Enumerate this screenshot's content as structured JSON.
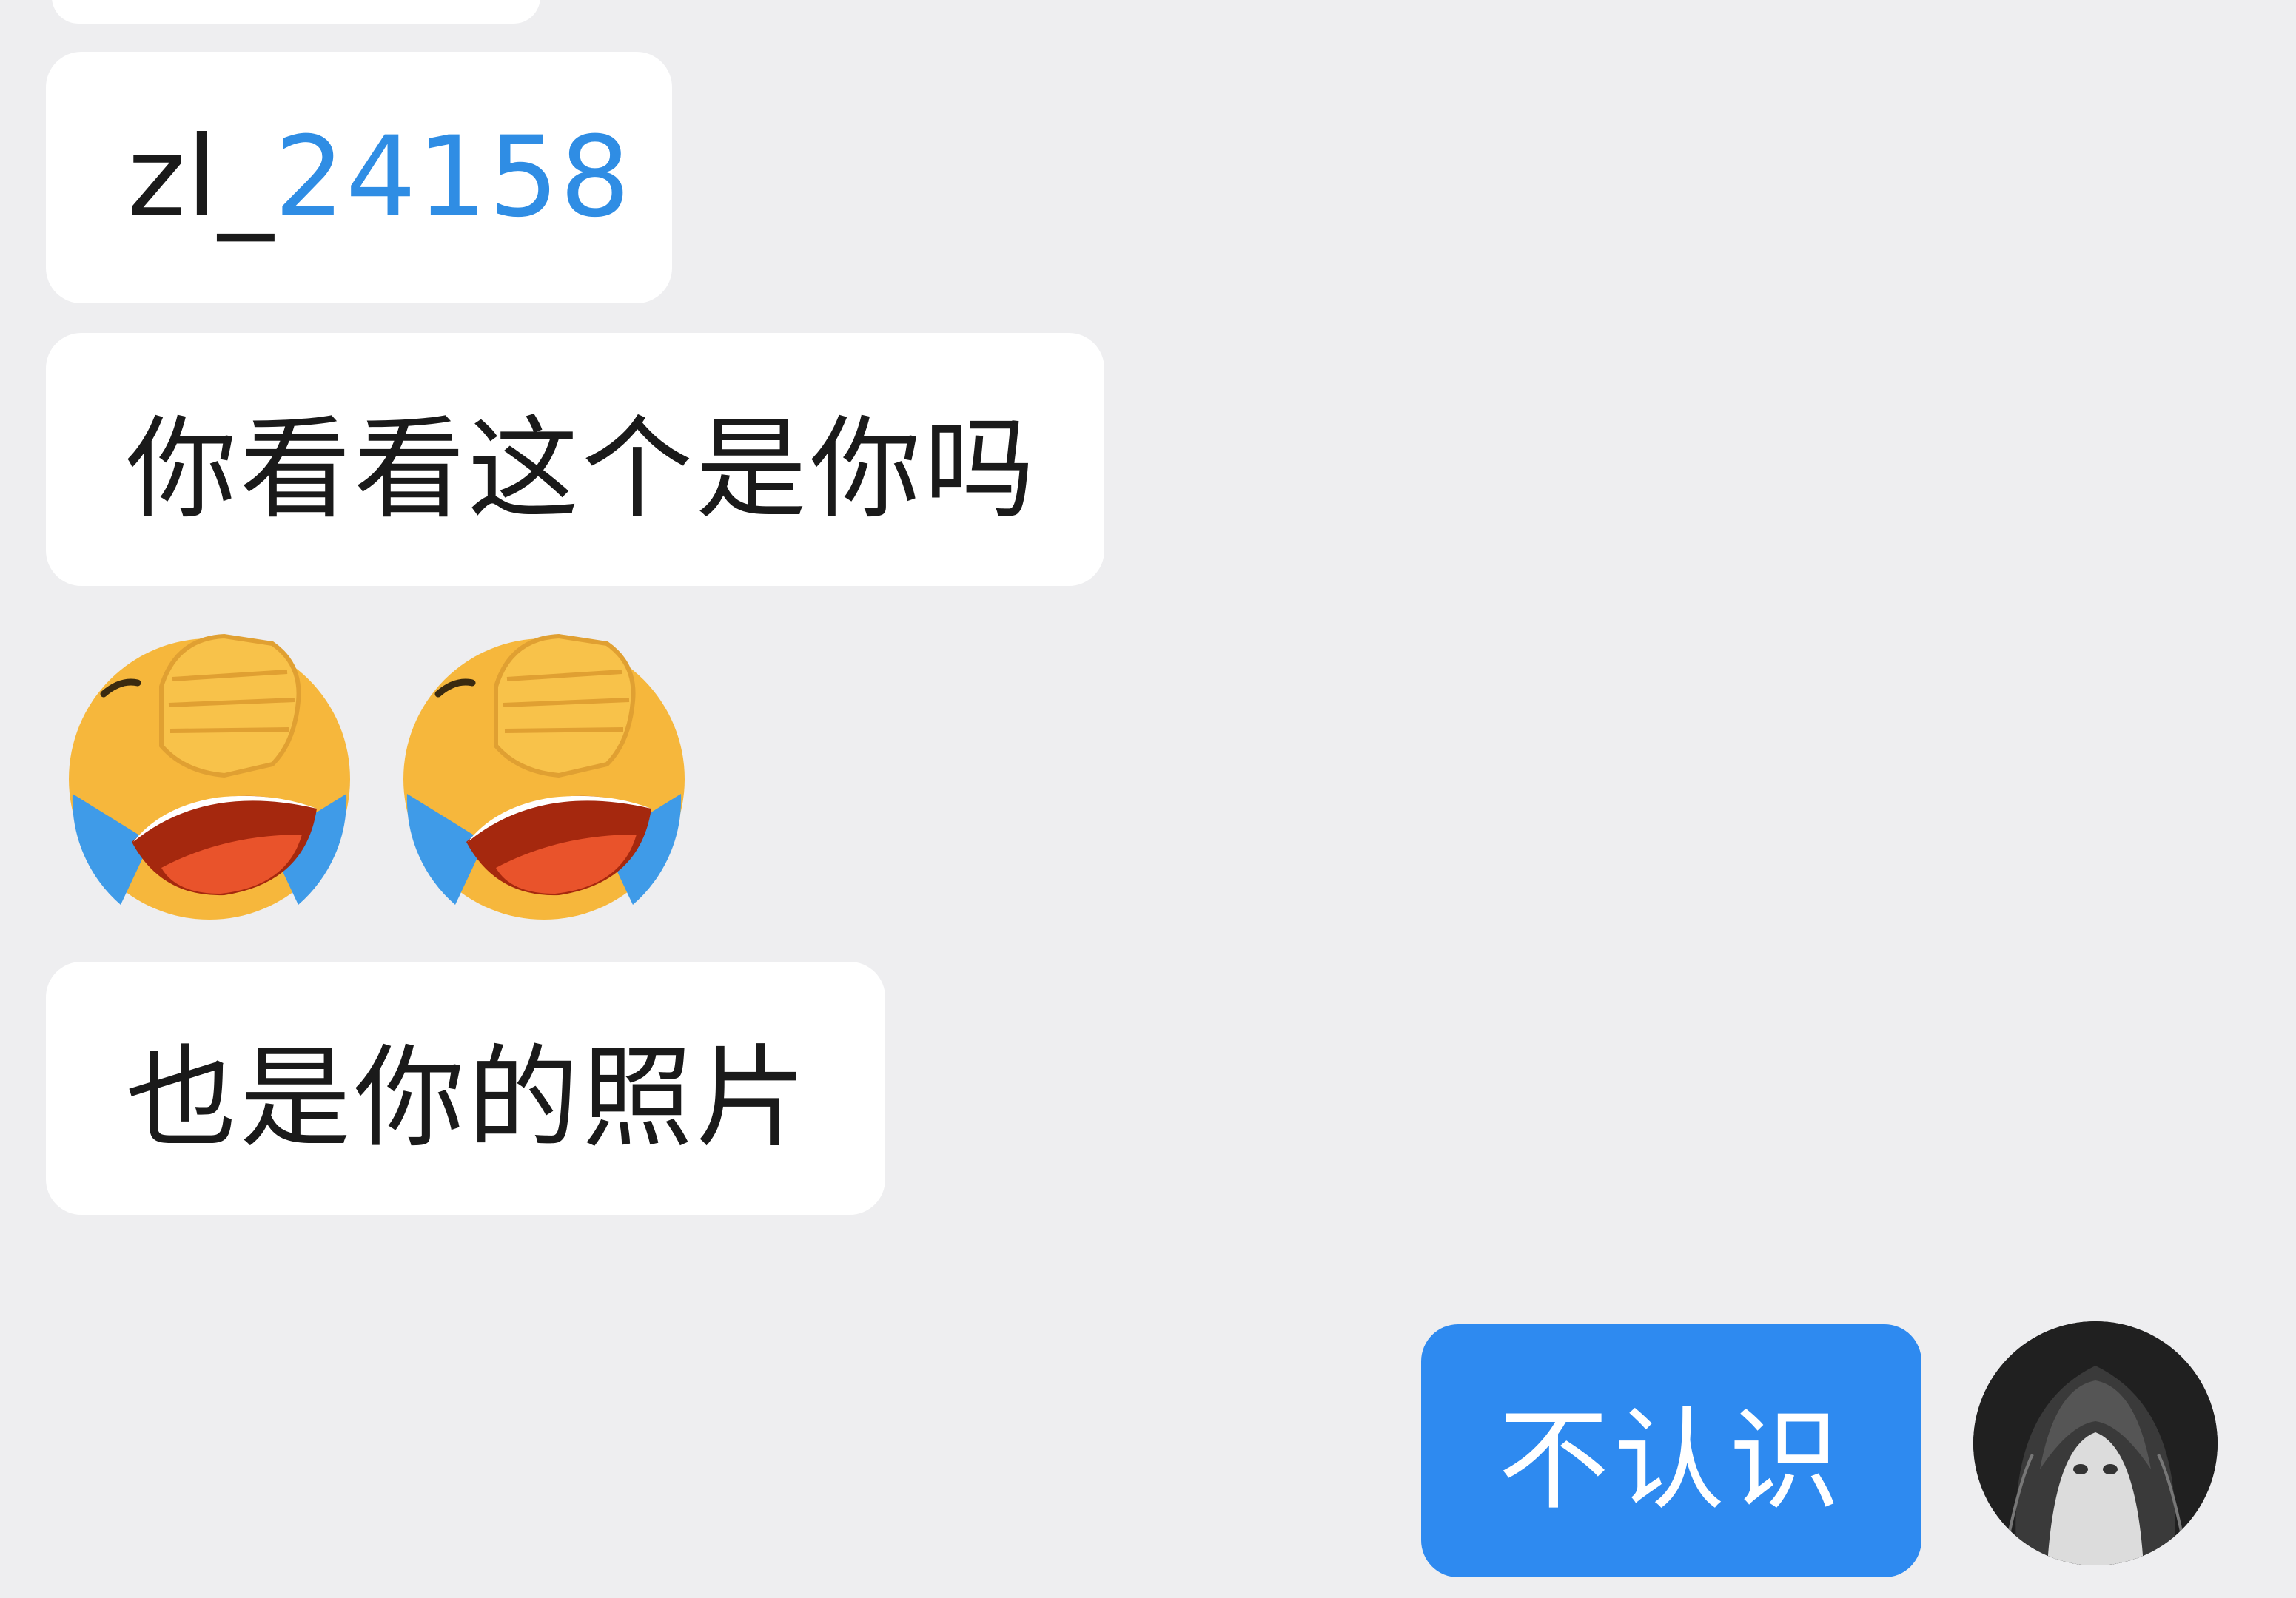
{
  "messages": [
    {
      "side": "left",
      "type": "text",
      "prefix": "zl_",
      "link": "24158"
    },
    {
      "side": "left",
      "type": "text",
      "text": "你看看这个是你吗"
    },
    {
      "side": "left",
      "type": "emoji",
      "emojis": [
        "facepalm-crying-emoji",
        "facepalm-crying-emoji"
      ]
    },
    {
      "side": "left",
      "type": "text",
      "text": "也是你的照片"
    },
    {
      "side": "right",
      "type": "text",
      "text": "不认识"
    }
  ],
  "colors": {
    "background": "#EEEEF0",
    "incoming_bubble": "#FFFFFF",
    "outgoing_bubble": "#2E8AF0",
    "link": "#2F8DE4",
    "text": "#1A1A1A"
  },
  "icons": {
    "avatar": "anime-girl-avatar"
  }
}
